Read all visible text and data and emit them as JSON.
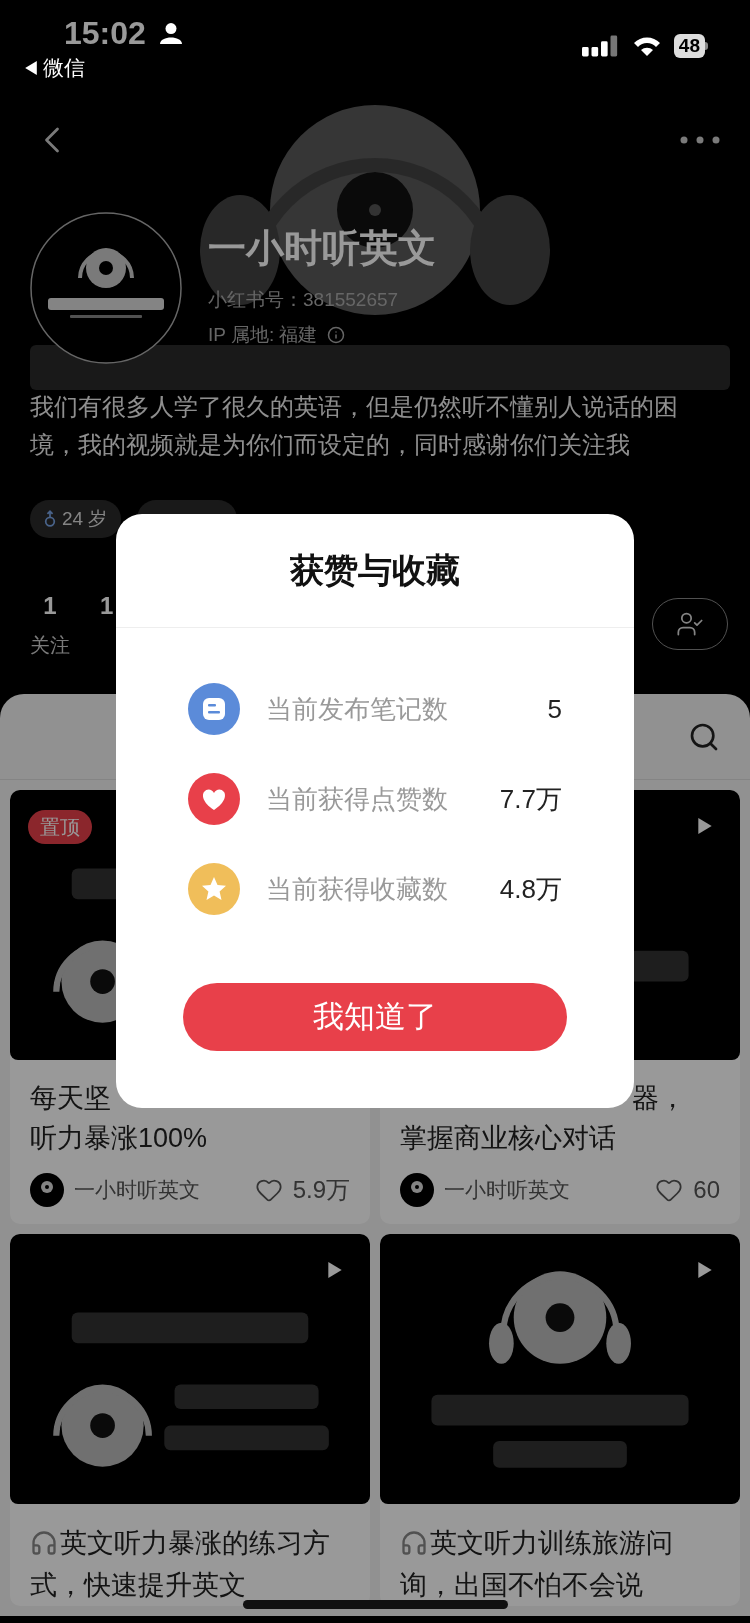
{
  "status_bar": {
    "time": "15:02",
    "back_app": "微信",
    "battery": "48"
  },
  "profile": {
    "name": "一小时听英文",
    "id_line": "小红书号：381552657",
    "ip_line": "IP 属地: 福建",
    "bio": "我们有很多人学了很久的英语，但是仍然听不懂别人说话的困境，我的视频就是为你们而设定的，同时感谢你们关注我",
    "tags": [
      {
        "kind": "age",
        "label": "24 岁"
      },
      {
        "kind": "location"
      }
    ],
    "stats": [
      {
        "value": "1",
        "label": "关注"
      },
      {
        "value": "1"
      }
    ]
  },
  "notes": [
    {
      "badge": "置顶",
      "play": false,
      "title_lines": [
        "每天坚",
        "听力暴涨100%"
      ],
      "author": "一小时听英文",
      "likes": "5.9万"
    },
    {
      "play": true,
      "title_lines": [
        "器，",
        "掌握商业核心对话"
      ],
      "author": "一小时听英文",
      "likes": "60"
    },
    {
      "play": true,
      "icon_title": [
        "英文听力暴涨的练习方",
        "式，快速提升英文"
      ]
    },
    {
      "play": true,
      "icon_title": [
        "英文听力训练旅游问",
        "询，出国不怕不会说"
      ]
    }
  ],
  "dialog": {
    "title": "获赞与收藏",
    "rows": [
      {
        "kind": "notes",
        "label": "当前发布笔记数",
        "value": "5"
      },
      {
        "kind": "likes",
        "label": "当前获得点赞数",
        "value": "7.7万"
      },
      {
        "kind": "collects",
        "label": "当前获得收藏数",
        "value": "4.8万"
      }
    ],
    "button": "我知道了"
  }
}
